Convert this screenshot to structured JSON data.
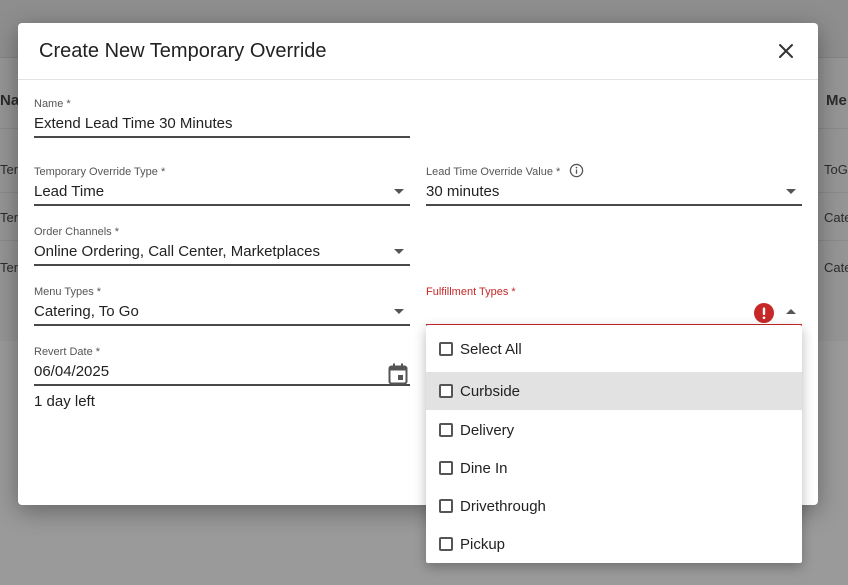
{
  "background": {
    "header_name_partial": "Na",
    "header_menu_partial": "Me",
    "rows": [
      {
        "left": "Tem",
        "right": "ToGo"
      },
      {
        "left": "Tem",
        "right": "Cate"
      },
      {
        "left": "Tem",
        "right": "Cate"
      }
    ]
  },
  "modal": {
    "title": "Create New Temporary Override",
    "close_icon": "close-icon"
  },
  "form": {
    "name": {
      "label": "Name *",
      "value": "Extend Lead Time 30 Minutes"
    },
    "override_type": {
      "label": "Temporary Override Type *",
      "value": "Lead Time"
    },
    "lead_time_value": {
      "label": "Lead Time Override Value *",
      "value": "30 minutes",
      "icon": "info-icon"
    },
    "order_channels": {
      "label": "Order Channels *",
      "value": "Online Ordering, Call Center, Marketplaces"
    },
    "menu_types": {
      "label": "Menu Types *",
      "value": "Catering, To Go"
    },
    "fulfillment_types": {
      "label": "Fulfillment Types *",
      "value": "",
      "icon": "error-icon"
    },
    "revert_date": {
      "label": "Revert Date *",
      "value": "06/04/2025",
      "icon": "calendar-icon",
      "helper": "1 day left"
    }
  },
  "dropdown": {
    "options": [
      "Select All",
      "Curbside",
      "Delivery",
      "Dine In",
      "Drivethrough",
      "Pickup"
    ],
    "hovered": "Curbside"
  },
  "colors": {
    "error": "#c62828",
    "hover": "#e2e2e2",
    "overlay": "#8f8f8f"
  }
}
